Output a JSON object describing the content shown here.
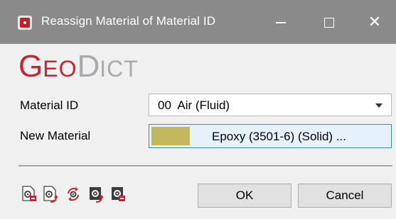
{
  "window": {
    "title": "Reassign Material of Material ID",
    "controls": {
      "minimize_icon": "minimize-icon",
      "maximize_icon": "maximize-icon",
      "close_icon": "close-icon"
    }
  },
  "logo": {
    "geo_first": "G",
    "geo_rest": "EO",
    "dict_first": "D",
    "dict_rest": "ICT"
  },
  "form": {
    "material_id_label": "Material ID",
    "material_id_value": "00  Air (Fluid)",
    "new_material_label": "New Material",
    "new_material_value": "Epoxy (3501-6) (Solid) ...",
    "new_material_swatch_color": "#c3b85c"
  },
  "toolbar_icons": [
    "gear-doc-lock-icon",
    "gear-doc-arrow-icon",
    "gear-refresh-icon",
    "dark-gear-arrow-icon",
    "dark-gear-lock-icon"
  ],
  "buttons": {
    "ok": "OK",
    "cancel": "Cancel"
  },
  "colors": {
    "brand_red": "#c6252f",
    "brand_gray": "#a9aaad",
    "titlebar": "#8a8a8a",
    "accent_blue": "#3c84d6"
  }
}
